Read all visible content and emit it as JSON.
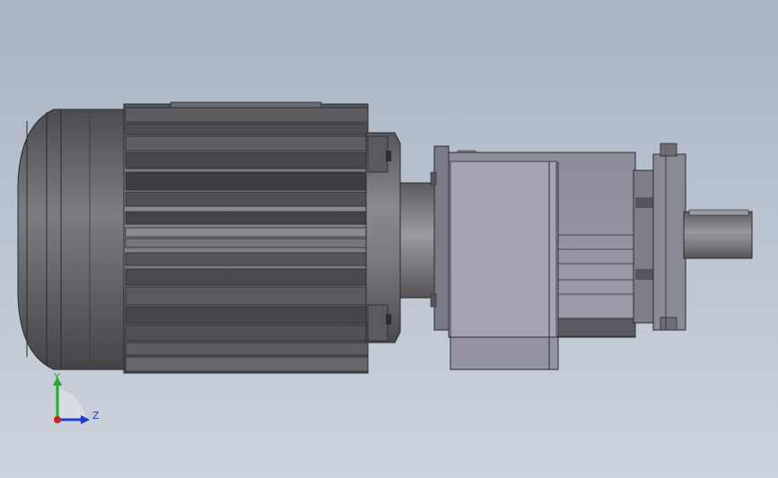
{
  "viewport": {
    "background_top": "#a9b4c4",
    "background_bottom": "#cdd3dc"
  },
  "model": {
    "name": "geared-motor",
    "body_color": "#6e6e72",
    "dark_color": "#3a3a3d",
    "gearbox_color": "#9a9aa8"
  },
  "triad": {
    "y_label": "Y",
    "z_label": "Z",
    "y_color": "#1fae2a",
    "z_color": "#1f3ad0",
    "x_color": "#d01f1f"
  }
}
